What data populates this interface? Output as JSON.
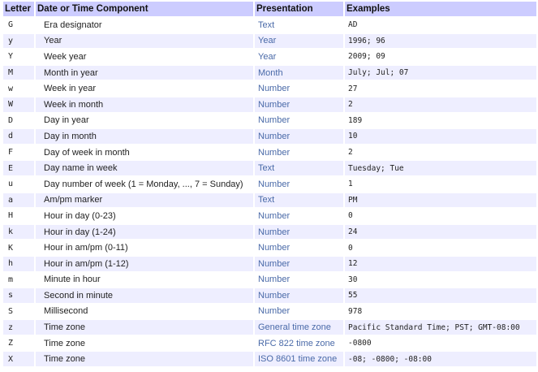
{
  "header": {
    "letter": "Letter",
    "component": "Date or Time Component",
    "presentation": "Presentation",
    "examples": "Examples"
  },
  "rows": [
    {
      "letter": "G",
      "component": "Era designator",
      "presentation": "Text",
      "example": "AD"
    },
    {
      "letter": "y",
      "component": "Year",
      "presentation": "Year",
      "example": "1996; 96"
    },
    {
      "letter": "Y",
      "component": "Week year",
      "presentation": "Year",
      "example": "2009; 09"
    },
    {
      "letter": "M",
      "component": "Month in year",
      "presentation": "Month",
      "example": "July; Jul; 07"
    },
    {
      "letter": "w",
      "component": "Week in year",
      "presentation": "Number",
      "example": "27"
    },
    {
      "letter": "W",
      "component": "Week in month",
      "presentation": "Number",
      "example": "2"
    },
    {
      "letter": "D",
      "component": "Day in year",
      "presentation": "Number",
      "example": "189"
    },
    {
      "letter": "d",
      "component": "Day in month",
      "presentation": "Number",
      "example": "10"
    },
    {
      "letter": "F",
      "component": "Day of week in month",
      "presentation": "Number",
      "example": "2"
    },
    {
      "letter": "E",
      "component": "Day name in week",
      "presentation": "Text",
      "example": "Tuesday; Tue"
    },
    {
      "letter": "u",
      "component": "Day number of week (1 = Monday, ..., 7 = Sunday)",
      "presentation": "Number",
      "example": "1"
    },
    {
      "letter": "a",
      "component": "Am/pm marker",
      "presentation": "Text",
      "example": "PM"
    },
    {
      "letter": "H",
      "component": "Hour in day (0-23)",
      "presentation": "Number",
      "example": "0"
    },
    {
      "letter": "k",
      "component": "Hour in day (1-24)",
      "presentation": "Number",
      "example": "24"
    },
    {
      "letter": "K",
      "component": "Hour in am/pm (0-11)",
      "presentation": "Number",
      "example": "0"
    },
    {
      "letter": "h",
      "component": "Hour in am/pm (1-12)",
      "presentation": "Number",
      "example": "12"
    },
    {
      "letter": "m",
      "component": "Minute in hour",
      "presentation": "Number",
      "example": "30"
    },
    {
      "letter": "s",
      "component": "Second in minute",
      "presentation": "Number",
      "example": "55"
    },
    {
      "letter": "S",
      "component": "Millisecond",
      "presentation": "Number",
      "example": "978"
    },
    {
      "letter": "z",
      "component": "Time zone",
      "presentation": "General time zone",
      "example": "Pacific Standard Time; PST; GMT-08:00"
    },
    {
      "letter": "Z",
      "component": "Time zone",
      "presentation": "RFC 822 time zone",
      "example": "-0800"
    },
    {
      "letter": "X",
      "component": "Time zone",
      "presentation": "ISO 8601 time zone",
      "example": "-08; -0800; -08:00"
    }
  ]
}
